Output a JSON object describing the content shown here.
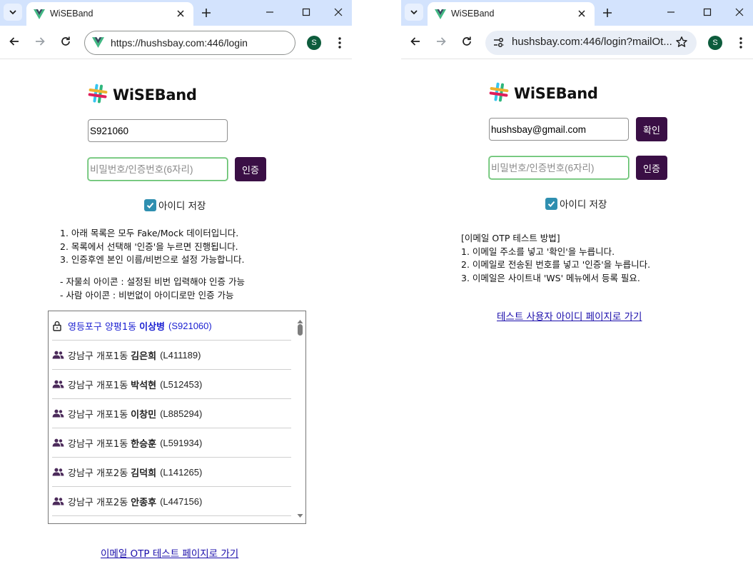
{
  "left": {
    "tab_title": "WiSEBand",
    "url": "https://hushsbay.com:446/login",
    "profile_initial": "S",
    "brand": "WiSEBand",
    "id_value": "S921060",
    "pw_placeholder": "비밀번호/인증번호(6자리)",
    "auth_button": "인증",
    "remember_label": "아이디 저장",
    "remember_checked": true,
    "guide_numbered": [
      "1. 아래 목록은 모두 Fake/Mock 데이터입니다.",
      "2. 목록에서 선택해 '인증'을 누르면 진행됩니다.",
      "3. 인증후엔 본인 이름/비번으로 설정 가능합니다."
    ],
    "guide_icons": [
      "- 자물쇠 아이콘 : 설정된 비번 입력해야 인증 가능",
      "- 사람 아이콘 : 비번없이 아이디로만 인증 가능"
    ],
    "users": [
      {
        "org": "영등포구 양평1동",
        "name": "이상병",
        "id": "(S921060)",
        "icon": "lock-icon",
        "selected": true
      },
      {
        "org": "강남구 개포1동",
        "name": "김은희",
        "id": "(L411189)",
        "icon": "people-icon",
        "selected": false
      },
      {
        "org": "강남구 개포1동",
        "name": "박석현",
        "id": "(L512453)",
        "icon": "people-icon",
        "selected": false
      },
      {
        "org": "강남구 개포1동",
        "name": "이창민",
        "id": "(L885294)",
        "icon": "people-icon",
        "selected": false
      },
      {
        "org": "강남구 개포1동",
        "name": "한승훈",
        "id": "(L591934)",
        "icon": "people-icon",
        "selected": false
      },
      {
        "org": "강남구 개포2동",
        "name": "김덕희",
        "id": "(L141265)",
        "icon": "people-icon",
        "selected": false
      },
      {
        "org": "강남구 개포2동",
        "name": "안종후",
        "id": "(L447156)",
        "icon": "people-icon",
        "selected": false
      }
    ],
    "bottom_link": "이메일 OTP 테스트 페이지로 가기"
  },
  "right": {
    "tab_title": "WiSEBand",
    "url": "hushsbay.com:446/login?mailOt...",
    "profile_initial": "S",
    "brand": "WiSEBand",
    "email_value": "hushsbay@gmail.com",
    "confirm_button": "확인",
    "pw_placeholder": "비밀번호/인증번호(6자리)",
    "auth_button": "인증",
    "remember_label": "아이디 저장",
    "remember_checked": true,
    "guide": [
      "[이메일 OTP 테스트 방법]",
      "1. 이메일 주소를 넣고 '확인'을 누릅니다.",
      "2. 이메일로 전송된 번호를 넣고 '인증'을 누릅니다.",
      "3. 이메일은 사이트내 'WS' 메뉴에서 등록 필요."
    ],
    "bottom_link": "테스트 사용자 아이디 페이지로 가기"
  },
  "colors": {
    "tabstrip": "#d3e3fd",
    "button": "#3a0f45",
    "checkbox": "#2f8fb0",
    "selected_user": "#1a1fd1",
    "link": "#1a0dab",
    "focus_border": "#5fbf6a"
  }
}
